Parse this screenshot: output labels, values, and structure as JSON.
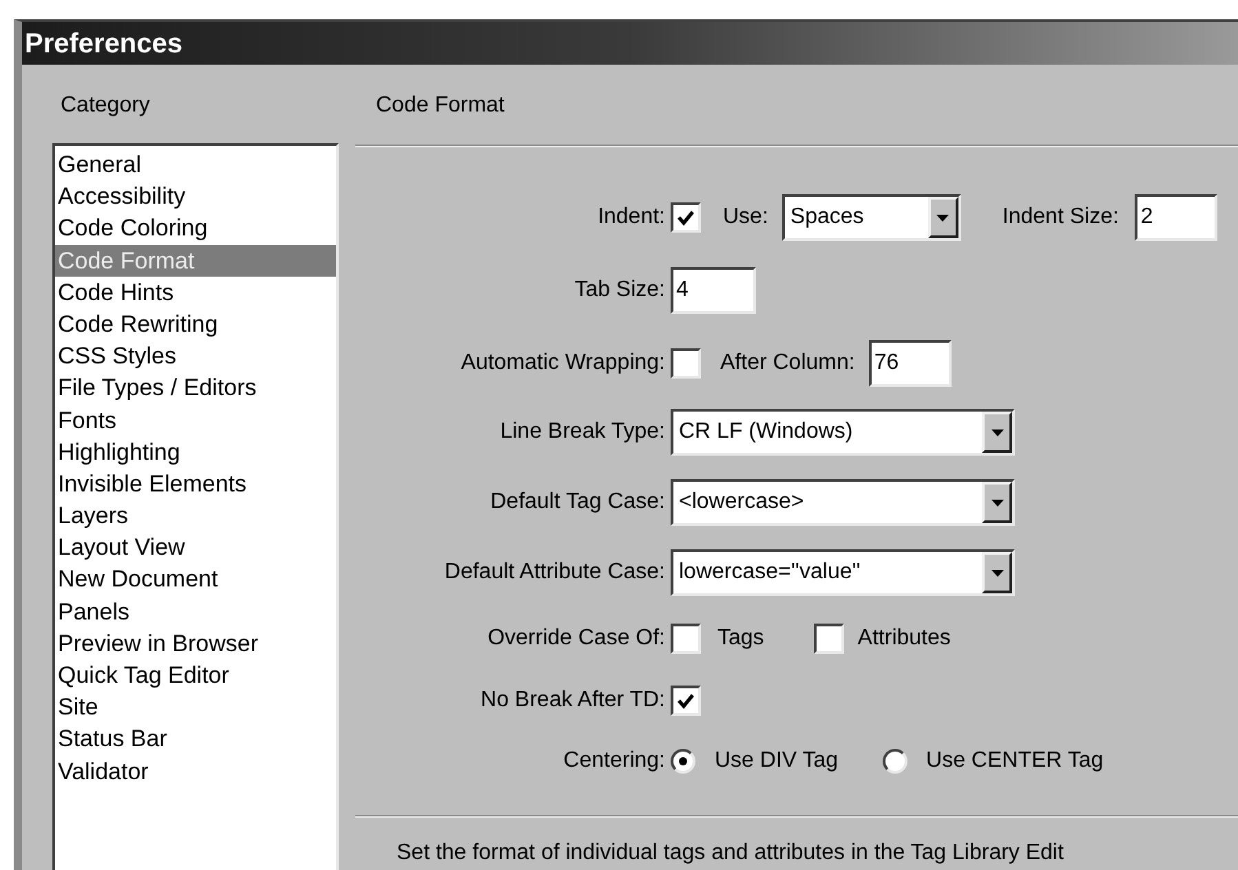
{
  "window": {
    "title": "Preferences"
  },
  "category": {
    "label": "Category",
    "items": [
      {
        "label": "General",
        "selected": false
      },
      {
        "label": "Accessibility",
        "selected": false
      },
      {
        "label": "Code Coloring",
        "selected": false
      },
      {
        "label": "Code Format",
        "selected": true
      },
      {
        "label": "Code Hints",
        "selected": false
      },
      {
        "label": "Code Rewriting",
        "selected": false
      },
      {
        "label": "CSS Styles",
        "selected": false
      },
      {
        "label": "File Types / Editors",
        "selected": false
      },
      {
        "label": "Fonts",
        "selected": false
      },
      {
        "label": "Highlighting",
        "selected": false
      },
      {
        "label": "Invisible Elements",
        "selected": false
      },
      {
        "label": "Layers",
        "selected": false
      },
      {
        "label": "Layout View",
        "selected": false
      },
      {
        "label": "New Document",
        "selected": false
      },
      {
        "label": "Panels",
        "selected": false
      },
      {
        "label": "Preview in Browser",
        "selected": false
      },
      {
        "label": "Quick Tag Editor",
        "selected": false
      },
      {
        "label": "Site",
        "selected": false
      },
      {
        "label": "Status Bar",
        "selected": false
      },
      {
        "label": "Validator",
        "selected": false
      }
    ]
  },
  "panel": {
    "title": "Code Format",
    "rows": [
      {
        "label": "Indent:",
        "controls": [
          {
            "kind": "checkbox",
            "checked": true
          },
          {
            "kind": "text",
            "text": "Use:"
          },
          {
            "kind": "dropdown",
            "value": "Spaces"
          },
          {
            "kind": "text",
            "text": "Indent Size:"
          },
          {
            "kind": "field",
            "value": "2"
          }
        ]
      },
      {
        "label": "Tab Size:",
        "controls": [
          {
            "kind": "field",
            "value": "4"
          }
        ]
      },
      {
        "label": "Automatic Wrapping:",
        "controls": [
          {
            "kind": "checkbox",
            "checked": false
          },
          {
            "kind": "text",
            "text": "After Column:"
          },
          {
            "kind": "field",
            "value": "76"
          }
        ]
      },
      {
        "label": "Line Break Type:",
        "controls": [
          {
            "kind": "dropdown",
            "value": "CR LF (Windows)"
          }
        ]
      },
      {
        "label": "Default Tag Case:",
        "controls": [
          {
            "kind": "dropdown",
            "value": "<lowercase>"
          }
        ]
      },
      {
        "label": "Default Attribute Case:",
        "controls": [
          {
            "kind": "dropdown",
            "value": "lowercase=''value''"
          }
        ]
      },
      {
        "label": "Override Case Of:",
        "controls": [
          {
            "kind": "checkbox",
            "checked": false
          },
          {
            "kind": "text",
            "text": "Tags"
          },
          {
            "kind": "checkbox",
            "checked": false
          },
          {
            "kind": "text",
            "text": "Attributes"
          }
        ]
      },
      {
        "label": "No Break After TD:",
        "controls": [
          {
            "kind": "checkbox",
            "checked": true
          }
        ]
      },
      {
        "label": "Centering:",
        "controls": [
          {
            "kind": "radio",
            "selected": true
          },
          {
            "kind": "text",
            "text": "Use DIV Tag"
          },
          {
            "kind": "radio",
            "selected": false
          },
          {
            "kind": "text",
            "text": "Use CENTER Tag"
          }
        ]
      }
    ],
    "note": "Set the format of individual tags and attributes in the Tag Library Edit"
  }
}
